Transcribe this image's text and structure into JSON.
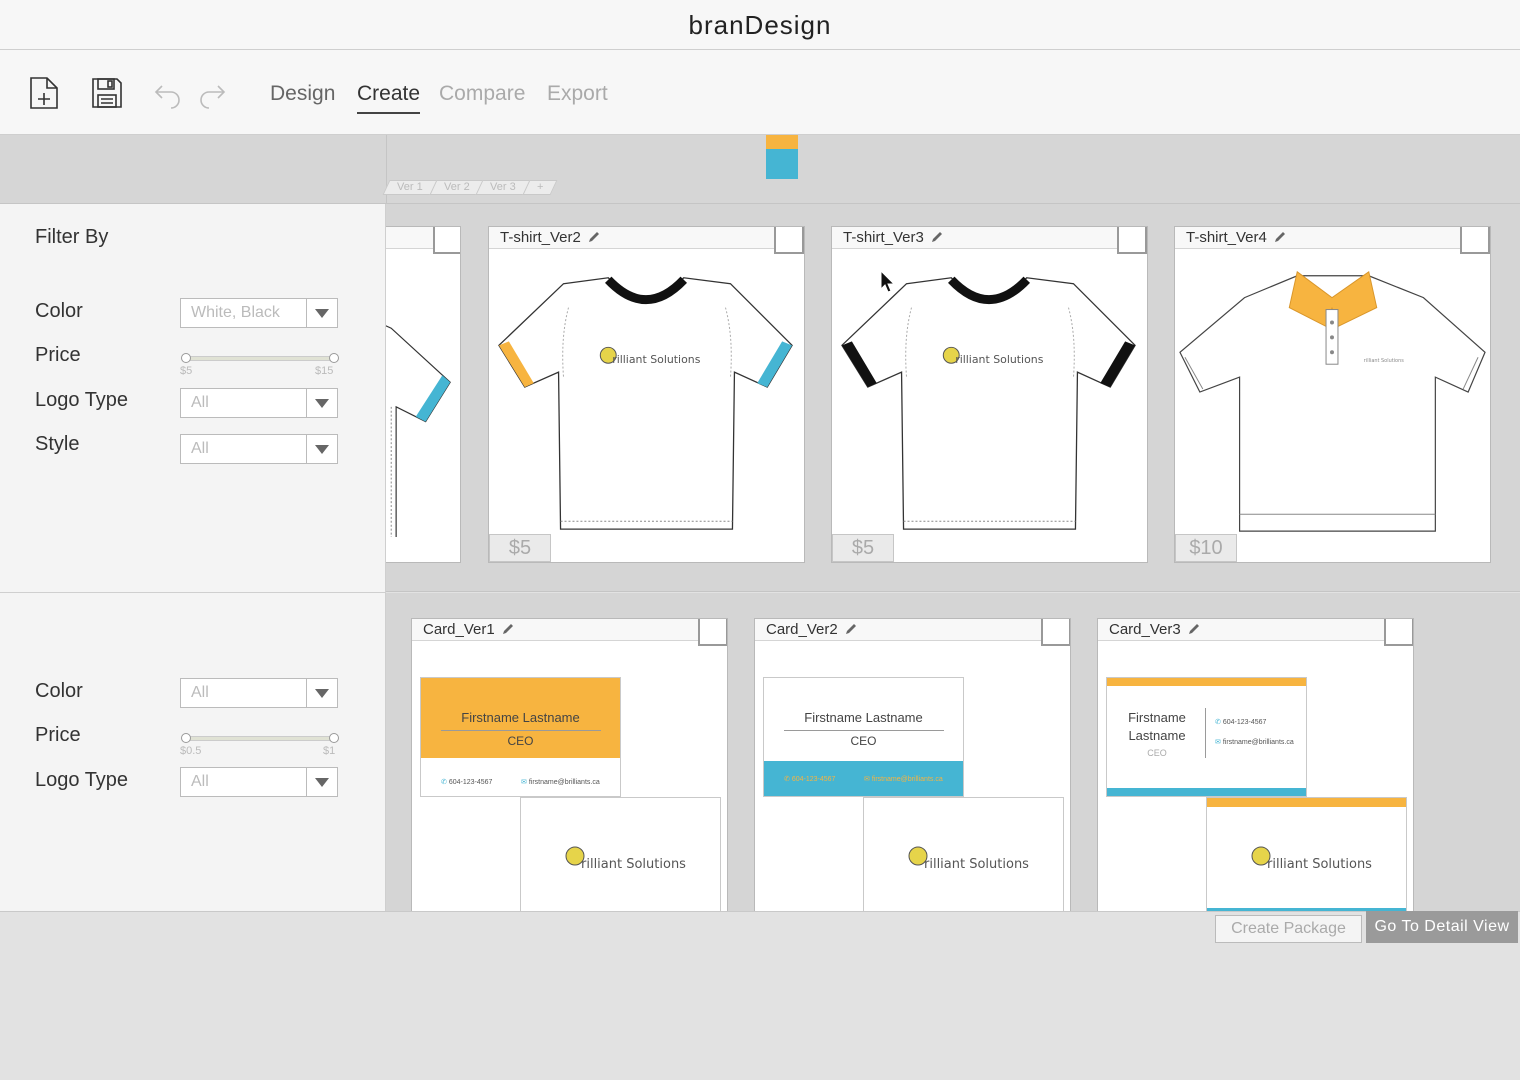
{
  "app": {
    "title": "branDesign"
  },
  "toolbar": {
    "icons": [
      "new-file-icon",
      "save-icon",
      "undo-icon",
      "redo-icon"
    ],
    "tabs": [
      {
        "label": "Design",
        "state": "normal"
      },
      {
        "label": "Create",
        "state": "active"
      },
      {
        "label": "Compare",
        "state": "disabled"
      },
      {
        "label": "Export",
        "state": "disabled"
      }
    ]
  },
  "versions": {
    "tabs": [
      "Ver 1",
      "Ver 2",
      "Ver 3",
      "+"
    ],
    "swatch_colors": [
      "#f7b440",
      "#45b5d3"
    ]
  },
  "filters": {
    "heading": "Filter By",
    "shirts": {
      "color": {
        "label": "Color",
        "value": "White, Black"
      },
      "price": {
        "label": "Price",
        "min": "$5",
        "max": "$15"
      },
      "logo_type": {
        "label": "Logo Type",
        "value": "All"
      },
      "style": {
        "label": "Style",
        "value": "All"
      }
    },
    "cards": {
      "color": {
        "label": "Color",
        "value": "All"
      },
      "price": {
        "label": "Price",
        "min": "$0.5",
        "max": "$1"
      },
      "logo_type": {
        "label": "Logo Type",
        "value": "All"
      }
    }
  },
  "shirts": [
    {
      "title": "",
      "price": "",
      "accent": "#45b5d3",
      "style": "tee-partial"
    },
    {
      "title": "T-shirt_Ver2",
      "price": "$5",
      "sleeve_left": "#f7b440",
      "sleeve_right": "#45b5d3",
      "collar": "#111111",
      "style": "tee"
    },
    {
      "title": "T-shirt_Ver3",
      "price": "$5",
      "sleeve_left": "#111111",
      "sleeve_right": "#111111",
      "collar": "#111111",
      "style": "tee"
    },
    {
      "title": "T-shirt_Ver4",
      "price": "$10",
      "collar": "#f7b440",
      "style": "polo"
    }
  ],
  "cards": [
    {
      "title": "Card_Ver1",
      "name": "Firstname Lastname",
      "role": "CEO",
      "phone": "604-123-4567",
      "email": "firstname@brilliants.ca",
      "front_color": "#f7b440",
      "style": "orange"
    },
    {
      "title": "Card_Ver2",
      "name": "Firstname Lastname",
      "role": "CEO",
      "phone": "604-123-4567",
      "email": "firstname@brilliants.ca",
      "band_color": "#45b5d3",
      "style": "blue-band"
    },
    {
      "title": "Card_Ver3",
      "name_line1": "Firstname",
      "name_line2": "Lastname",
      "role": "CEO",
      "phone": "604-123-4567",
      "email": "firstname@brilliants.ca",
      "top_color": "#f7b440",
      "bottom_color": "#45b5d3",
      "style": "stripes"
    }
  ],
  "logo": {
    "text": "rilliant Solutions"
  },
  "buttons": {
    "create_package": "Create Package",
    "go_to_detail": "Go To Detail View"
  }
}
